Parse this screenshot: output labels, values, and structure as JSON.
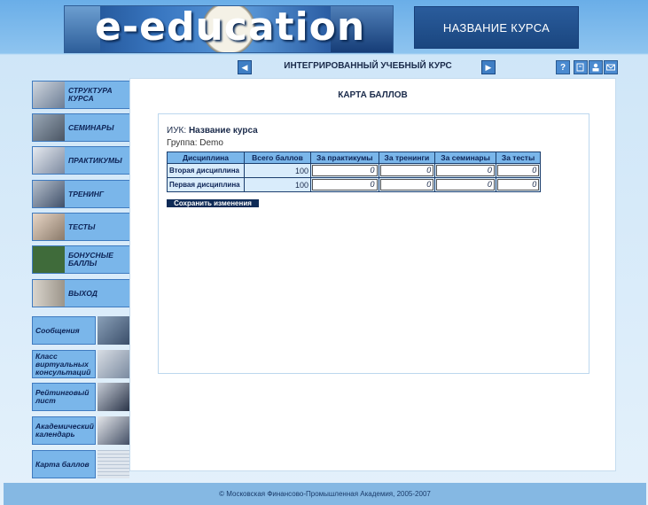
{
  "header": {
    "logo_text": "e-education",
    "course_name": "НАЗВАНИЕ КУРСА"
  },
  "nav": {
    "prev_symbol": "◀",
    "title": "ИНТЕГРИРОВАННЫЙ УЧЕБНЫЙ КУРС",
    "next_symbol": "▶",
    "help_symbol": "?"
  },
  "sidebar": {
    "items": [
      {
        "label": "СТРУКТУРА КУРСА"
      },
      {
        "label": "СЕМИНАРЫ"
      },
      {
        "label": "ПРАКТИКУМЫ"
      },
      {
        "label": "ТРЕНИНГ"
      },
      {
        "label": "ТЕСТЫ"
      },
      {
        "label": "БОНУСНЫЕ БАЛЛЫ"
      },
      {
        "label": "ВЫХОД"
      }
    ],
    "tools": [
      {
        "label": "Сообщения"
      },
      {
        "label": "Класс виртуальных консультаций"
      },
      {
        "label": "Рейтинговый лист"
      },
      {
        "label": "Академический календарь"
      },
      {
        "label": "Карта баллов"
      }
    ]
  },
  "main": {
    "title": "КАРТА БАЛЛОВ",
    "iuk_label": "ИУК:",
    "iuk_value": "Название курса",
    "group": "Группа: Demo",
    "table": {
      "headers": [
        "Дисциплина",
        "Всего баллов",
        "За практикумы",
        "За тренинги",
        "За семинары",
        "За тесты"
      ],
      "rows": [
        {
          "name": "Вторая дисциплина",
          "total": "100",
          "values": [
            "0",
            "0",
            "0",
            "0"
          ]
        },
        {
          "name": "Первая дисциплина",
          "total": "100",
          "values": [
            "0",
            "0",
            "0",
            "0"
          ]
        }
      ]
    },
    "save_label": "Сохранить изменения"
  },
  "footer": {
    "text": "© Московская Финансово-Промышленная Академия, 2005-2007"
  },
  "colors": {
    "header_blue": "#6aaee8",
    "button_blue": "#7ab6ea",
    "dark_navy": "#0e2a56"
  }
}
